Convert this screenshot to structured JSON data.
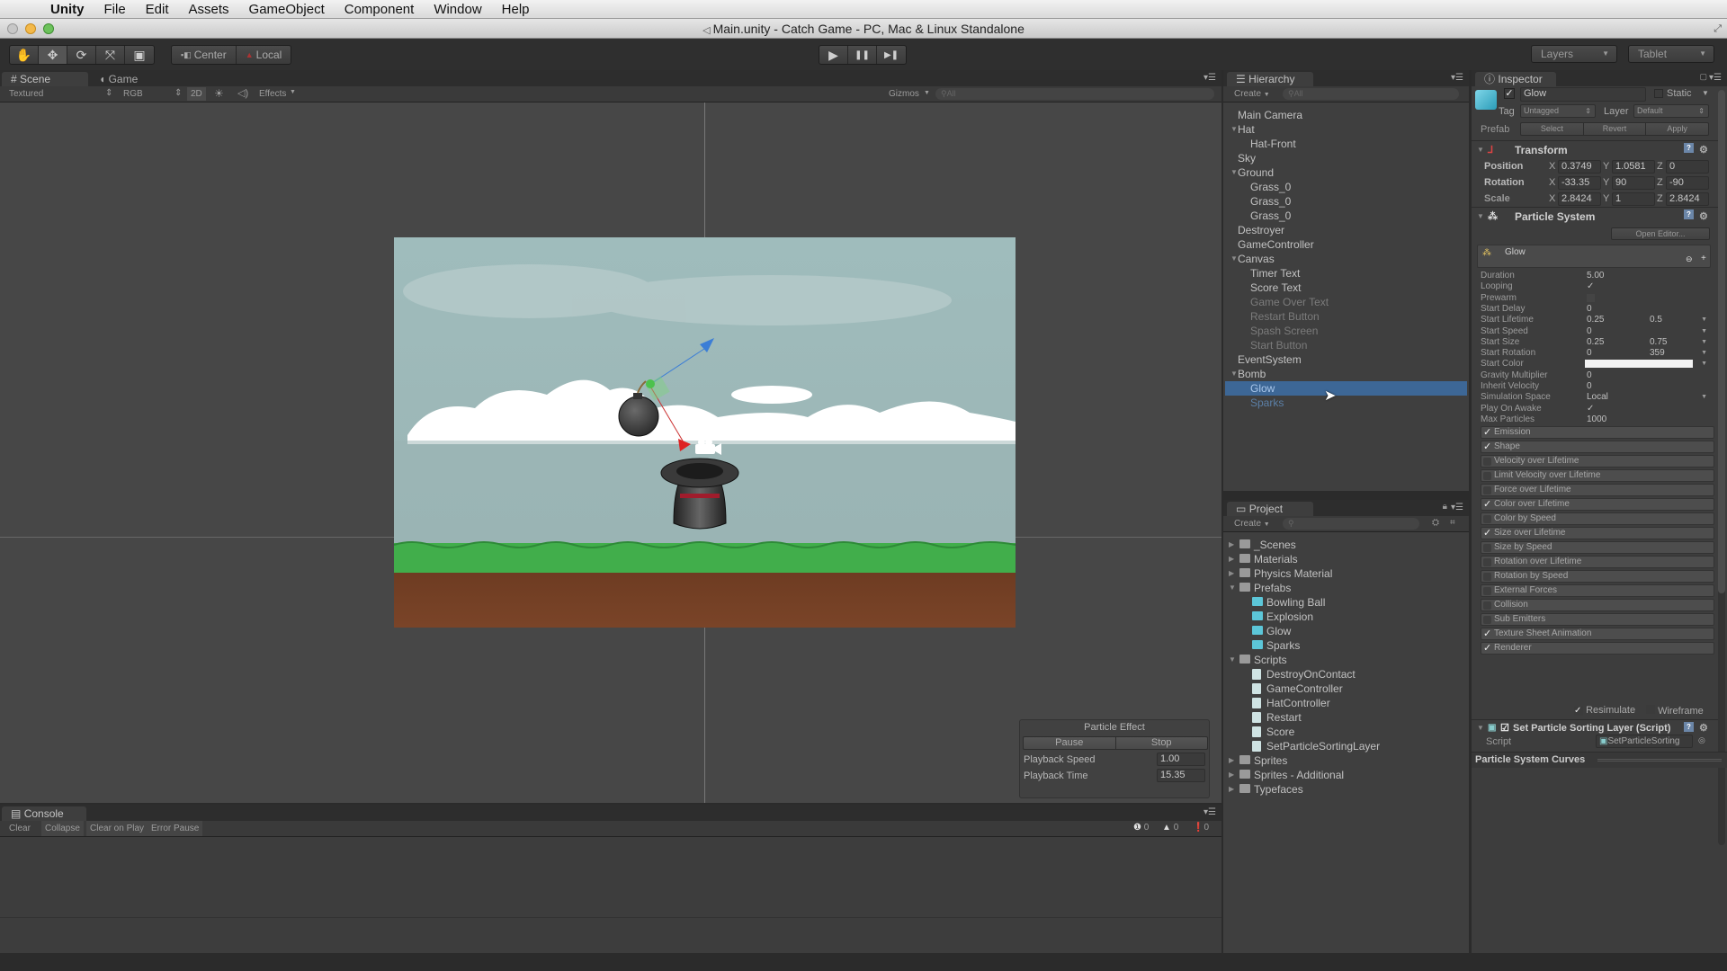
{
  "menubar": {
    "apple_icon": "apple-icon",
    "items": [
      "Unity",
      "File",
      "Edit",
      "Assets",
      "GameObject",
      "Component",
      "Window",
      "Help"
    ]
  },
  "window": {
    "title": "Main.unity - Catch Game - PC, Mac & Linux Standalone"
  },
  "toolbar": {
    "tools": [
      {
        "name": "hand-tool",
        "icon": "✋"
      },
      {
        "name": "move-tool",
        "icon": "✥"
      },
      {
        "name": "rotate-tool",
        "icon": "⟳"
      },
      {
        "name": "scale-tool",
        "icon": "⤧"
      },
      {
        "name": "rect-tool",
        "icon": "▣"
      }
    ],
    "pivot_center": "Center",
    "pivot_local": "Local",
    "play_icon": "▶",
    "pause_icon": "❚❚",
    "step_icon": "▶❚",
    "layers": "Layers",
    "layout": "Tablet"
  },
  "scene": {
    "tab_scene": "Scene",
    "tab_game": "Game",
    "shading": "Textured",
    "render_mode": "RGB",
    "mode_2d": "2D",
    "effects": "Effects",
    "gizmos": "Gizmos",
    "search_placeholder": "All"
  },
  "particle_effect": {
    "title": "Particle Effect",
    "pause": "Pause",
    "stop": "Stop",
    "playback_speed_label": "Playback Speed",
    "playback_speed": "1.00",
    "playback_time_label": "Playback Time",
    "playback_time": "15.35"
  },
  "console": {
    "tab": "Console",
    "buttons": [
      "Clear",
      "Collapse",
      "Clear on Play",
      "Error Pause"
    ],
    "info_count": "0",
    "warning_count": "0",
    "error_count": "0"
  },
  "hierarchy": {
    "tab": "Hierarchy",
    "create": "Create",
    "search_placeholder": "All",
    "items": [
      {
        "label": "Main Camera",
        "depth": 0,
        "expanded": null,
        "state": "normal"
      },
      {
        "label": "Hat",
        "depth": 0,
        "expanded": true,
        "state": "normal"
      },
      {
        "label": "Hat-Front",
        "depth": 1,
        "expanded": null,
        "state": "normal"
      },
      {
        "label": "Sky",
        "depth": 0,
        "expanded": null,
        "state": "normal"
      },
      {
        "label": "Ground",
        "depth": 0,
        "expanded": true,
        "state": "normal"
      },
      {
        "label": "Grass_0",
        "depth": 1,
        "expanded": null,
        "state": "normal"
      },
      {
        "label": "Grass_0",
        "depth": 1,
        "expanded": null,
        "state": "normal"
      },
      {
        "label": "Grass_0",
        "depth": 1,
        "expanded": null,
        "state": "normal"
      },
      {
        "label": "Destroyer",
        "depth": 0,
        "expanded": null,
        "state": "normal"
      },
      {
        "label": "GameController",
        "depth": 0,
        "expanded": null,
        "state": "normal"
      },
      {
        "label": "Canvas",
        "depth": 0,
        "expanded": true,
        "state": "normal"
      },
      {
        "label": "Timer Text",
        "depth": 1,
        "expanded": null,
        "state": "normal"
      },
      {
        "label": "Score Text",
        "depth": 1,
        "expanded": null,
        "state": "normal"
      },
      {
        "label": "Game Over Text",
        "depth": 1,
        "expanded": null,
        "state": "inactive"
      },
      {
        "label": "Restart Button",
        "depth": 1,
        "expanded": null,
        "state": "inactive"
      },
      {
        "label": "Spash Screen",
        "depth": 1,
        "expanded": null,
        "state": "inactive"
      },
      {
        "label": "Start Button",
        "depth": 1,
        "expanded": null,
        "state": "inactive"
      },
      {
        "label": "EventSystem",
        "depth": 0,
        "expanded": null,
        "state": "normal"
      },
      {
        "label": "Bomb",
        "depth": 0,
        "expanded": true,
        "state": "normal"
      },
      {
        "label": "Glow",
        "depth": 1,
        "expanded": null,
        "state": "selected"
      },
      {
        "label": "Sparks",
        "depth": 1,
        "expanded": null,
        "state": "prefab-dim"
      }
    ]
  },
  "project": {
    "tab": "Project",
    "create": "Create",
    "items": [
      {
        "label": "_Scenes",
        "depth": 0,
        "type": "folder",
        "expanded": false
      },
      {
        "label": "Materials",
        "depth": 0,
        "type": "folder",
        "expanded": false
      },
      {
        "label": "Physics Material",
        "depth": 0,
        "type": "folder",
        "expanded": false
      },
      {
        "label": "Prefabs",
        "depth": 0,
        "type": "folder",
        "expanded": true
      },
      {
        "label": "Bowling Ball",
        "depth": 1,
        "type": "prefab",
        "expanded": null
      },
      {
        "label": "Explosion",
        "depth": 1,
        "type": "prefab",
        "expanded": null
      },
      {
        "label": "Glow",
        "depth": 1,
        "type": "prefab",
        "expanded": null
      },
      {
        "label": "Sparks",
        "depth": 1,
        "type": "prefab",
        "expanded": null
      },
      {
        "label": "Scripts",
        "depth": 0,
        "type": "folder",
        "expanded": true
      },
      {
        "label": "DestroyOnContact",
        "depth": 1,
        "type": "script",
        "expanded": null
      },
      {
        "label": "GameController",
        "depth": 1,
        "type": "script",
        "expanded": null
      },
      {
        "label": "HatController",
        "depth": 1,
        "type": "script",
        "expanded": null
      },
      {
        "label": "Restart",
        "depth": 1,
        "type": "script",
        "expanded": null
      },
      {
        "label": "Score",
        "depth": 1,
        "type": "script",
        "expanded": null
      },
      {
        "label": "SetParticleSortingLayer",
        "depth": 1,
        "type": "script",
        "expanded": null
      },
      {
        "label": "Sprites",
        "depth": 0,
        "type": "folder",
        "expanded": false
      },
      {
        "label": "Sprites - Additional",
        "depth": 0,
        "type": "folder",
        "expanded": false
      },
      {
        "label": "Typefaces",
        "depth": 0,
        "type": "folder",
        "expanded": false
      }
    ]
  },
  "inspector": {
    "tab": "Inspector",
    "object_name": "Glow",
    "active": true,
    "static_label": "Static",
    "tag_label": "Tag",
    "tag_value": "Untagged",
    "layer_label": "Layer",
    "layer_value": "Default",
    "prefab_label": "Prefab",
    "prefab_buttons": [
      "Select",
      "Revert",
      "Apply"
    ],
    "transform": {
      "title": "Transform",
      "position": {
        "label": "Position",
        "x": "0.3749",
        "y": "1.0581",
        "z": "0"
      },
      "rotation": {
        "label": "Rotation",
        "x": "-33.35",
        "y": "90",
        "z": "-90"
      },
      "scale": {
        "label": "Scale",
        "x": "2.8424",
        "y": "1",
        "z": "2.8424"
      }
    },
    "particle_system": {
      "title": "Particle System",
      "open_editor": "Open Editor...",
      "system_name": "Glow",
      "fields": [
        {
          "label": "Duration",
          "v1": "5.00",
          "v2": "",
          "dropdown": false
        },
        {
          "label": "Looping",
          "v1": "✓",
          "v2": "",
          "dropdown": false
        },
        {
          "label": "Prewarm",
          "v1": "",
          "v2": "",
          "dropdown": false
        },
        {
          "label": "Start Delay",
          "v1": "0",
          "v2": "",
          "dropdown": false
        },
        {
          "label": "Start Lifetime",
          "v1": "0.25",
          "v2": "0.5",
          "dropdown": true
        },
        {
          "label": "Start Speed",
          "v1": "0",
          "v2": "",
          "dropdown": true
        },
        {
          "label": "Start Size",
          "v1": "0.25",
          "v2": "0.75",
          "dropdown": true
        },
        {
          "label": "Start Rotation",
          "v1": "0",
          "v2": "359",
          "dropdown": true
        },
        {
          "label": "Start Color",
          "v1": "",
          "v2": "",
          "dropdown": true
        },
        {
          "label": "Gravity Multiplier",
          "v1": "0",
          "v2": "",
          "dropdown": false
        },
        {
          "label": "Inherit Velocity",
          "v1": "0",
          "v2": "",
          "dropdown": false
        },
        {
          "label": "Simulation Space",
          "v1": "Local",
          "v2": "",
          "dropdown": true
        },
        {
          "label": "Play On Awake",
          "v1": "✓",
          "v2": "",
          "dropdown": false
        },
        {
          "label": "Max Particles",
          "v1": "1000",
          "v2": "",
          "dropdown": false
        }
      ],
      "start_color": "#f2f2f2",
      "modules": [
        {
          "label": "Emission",
          "enabled": true
        },
        {
          "label": "Shape",
          "enabled": true
        },
        {
          "label": "Velocity over Lifetime",
          "enabled": false
        },
        {
          "label": "Limit Velocity over Lifetime",
          "enabled": false
        },
        {
          "label": "Force over Lifetime",
          "enabled": false
        },
        {
          "label": "Color over Lifetime",
          "enabled": true
        },
        {
          "label": "Color by Speed",
          "enabled": false
        },
        {
          "label": "Size over Lifetime",
          "enabled": true
        },
        {
          "label": "Size by Speed",
          "enabled": false
        },
        {
          "label": "Rotation over Lifetime",
          "enabled": false
        },
        {
          "label": "Rotation by Speed",
          "enabled": false
        },
        {
          "label": "External Forces",
          "enabled": false
        },
        {
          "label": "Collision",
          "enabled": false
        },
        {
          "label": "Sub Emitters",
          "enabled": false
        },
        {
          "label": "Texture Sheet Animation",
          "enabled": true
        },
        {
          "label": "Renderer",
          "enabled": true
        }
      ],
      "resimulate": "Resimulate",
      "resimulate_checked": true,
      "wireframe": "Wireframe",
      "wireframe_checked": false
    },
    "script_component": {
      "title": "Set Particle Sorting Layer (Script)",
      "script_label": "Script",
      "script_value": "SetParticleSorting"
    },
    "curves_title": "Particle System Curves"
  },
  "colors": {
    "selection": "#3d6796",
    "sky": "#9cb6b6",
    "grass": "#3fae4a",
    "dirt": "#6b3b24"
  }
}
